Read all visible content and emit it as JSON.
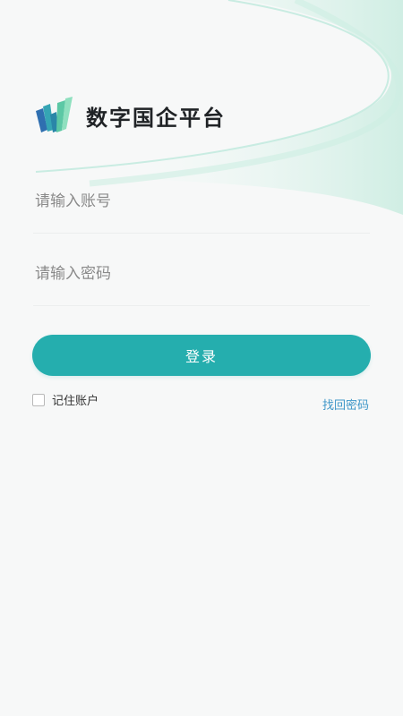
{
  "app": {
    "title": "数字国企平台"
  },
  "login_form": {
    "account_placeholder": "请输入账号",
    "password_placeholder": "请输入密码",
    "login_label": "登录",
    "remember_label": "记住账户",
    "forgot_label": "找回密码"
  },
  "colors": {
    "primary": "#25aeae",
    "link": "#3f97c8",
    "arc": "#a8e4cf"
  },
  "icons": [
    "app-logo-icon",
    "checkbox-icon"
  ]
}
